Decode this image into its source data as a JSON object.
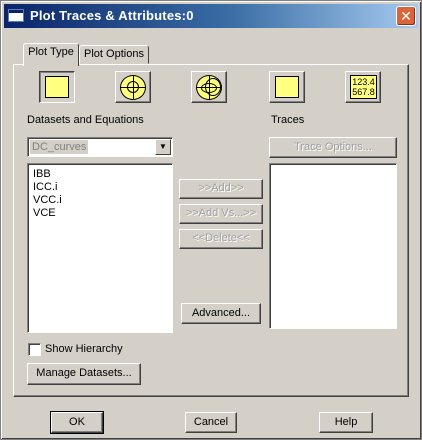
{
  "window": {
    "title": "Plot Traces & Attributes:0",
    "close_glyph": "✕"
  },
  "tabs": [
    {
      "label": "Plot Type",
      "active": true
    },
    {
      "label": "Plot Options",
      "active": false
    }
  ],
  "plot_types": [
    {
      "icon": "rectangular-plot-icon",
      "selected": true
    },
    {
      "icon": "polar-plot-icon",
      "selected": false
    },
    {
      "icon": "smith-chart-icon",
      "selected": false
    },
    {
      "icon": "stacked-plot-icon",
      "selected": false
    },
    {
      "icon": "list-table-icon",
      "selected": false,
      "text_line1": "123.4",
      "text_line2": "567.8"
    }
  ],
  "datasets": {
    "heading": "Datasets and Equations",
    "selected_dataset": "DC_curves",
    "dropdown_arrow": "▼",
    "variables": [
      "IBB",
      "ICC.i",
      "VCC.i",
      "VCE"
    ]
  },
  "traces": {
    "heading": "Traces",
    "trace_options_label": "Trace Options..."
  },
  "actions": {
    "add_label": ">>Add>>",
    "add_vs_label": ">>Add Vs...>>",
    "delete_label": "<<Delete<<",
    "advanced_label": "Advanced..."
  },
  "show_hierarchy": {
    "label": "Show Hierarchy",
    "checked": false
  },
  "manage_datasets_label": "Manage Datasets...",
  "footer": {
    "ok_label": "OK",
    "cancel_label": "Cancel",
    "help_label": "Help"
  }
}
